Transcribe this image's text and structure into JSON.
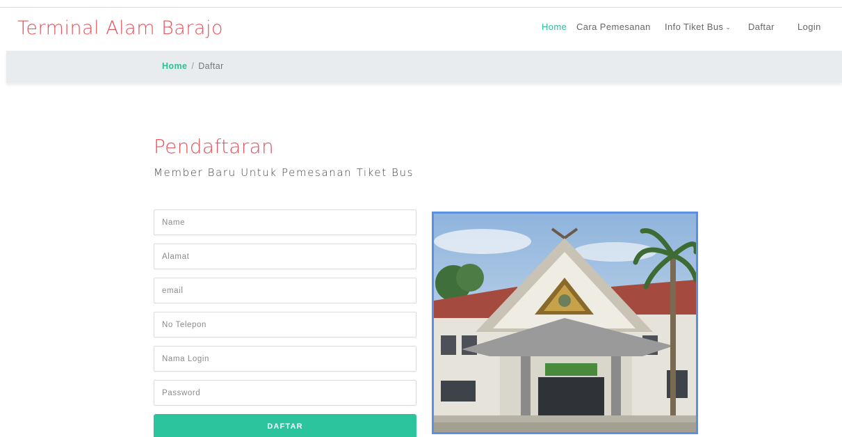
{
  "header": {
    "brand": "Terminal Alam Barajo",
    "nav": [
      {
        "label": "Home",
        "active": true
      },
      {
        "label": "Cara Pemesanan",
        "active": false
      },
      {
        "label": "Info Tiket Bus",
        "active": false,
        "dropdown": true,
        "icon": "chevron-down-icon"
      },
      {
        "label": "Daftar",
        "active": false
      },
      {
        "label": "Login",
        "active": false
      }
    ]
  },
  "breadcrumb": {
    "home": "Home",
    "separator": "/",
    "current": "Daftar"
  },
  "page": {
    "title": "Pendaftaran",
    "subtitle": "Member Baru Untuk Pemesanan Tiket Bus"
  },
  "form": {
    "name_placeholder": "Name",
    "alamat_placeholder": "Alamat",
    "email_placeholder": "email",
    "telepon_placeholder": "No Telepon",
    "login_placeholder": "Nama Login",
    "password_placeholder": "Password",
    "submit_label": "DAFTAR"
  },
  "colors": {
    "brand": "#e8525b",
    "accent": "#2cbf98",
    "button": "#2cc49c",
    "image_border": "#5b8fe0",
    "breadcrumb_bg": "#e9ecee"
  }
}
